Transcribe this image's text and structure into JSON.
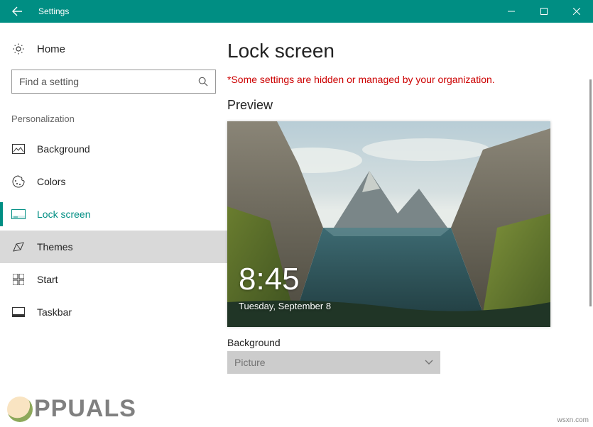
{
  "window": {
    "title": "Settings"
  },
  "sidebar": {
    "home": "Home",
    "search_placeholder": "Find a setting",
    "section": "Personalization",
    "items": [
      {
        "label": "Background"
      },
      {
        "label": "Colors"
      },
      {
        "label": "Lock screen"
      },
      {
        "label": "Themes"
      },
      {
        "label": "Start"
      },
      {
        "label": "Taskbar"
      }
    ]
  },
  "main": {
    "title": "Lock screen",
    "warning": "*Some settings are hidden or managed by your organization.",
    "preview_label": "Preview",
    "preview_time": "8:45",
    "preview_date": "Tuesday, September 8",
    "background_label": "Background",
    "background_value": "Picture"
  },
  "watermark": {
    "text": "PPUALS",
    "corner": "wsxn.com"
  }
}
